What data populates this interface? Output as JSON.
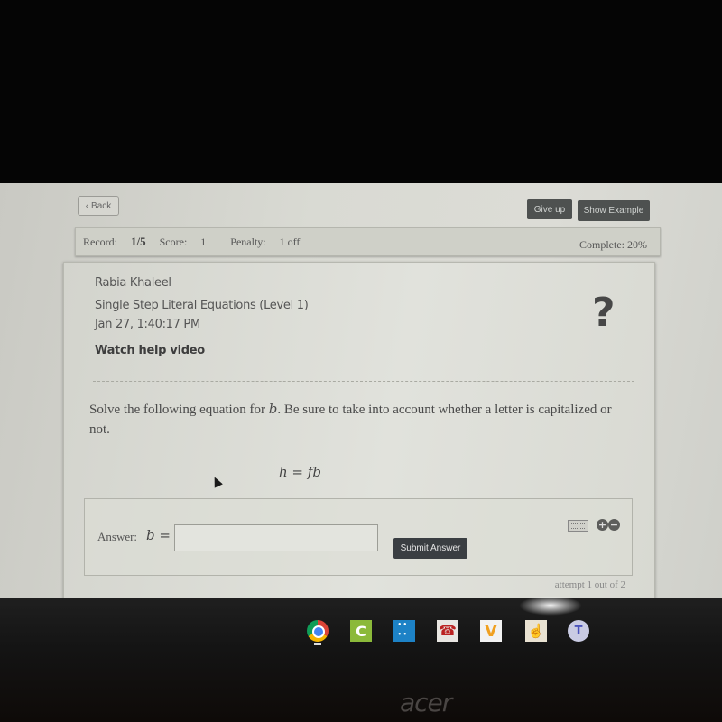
{
  "nav": {
    "back_label": "Back",
    "back_icon": "chevron-left-icon",
    "give_up_label": "Give up",
    "show_example_label": "Show Example"
  },
  "status": {
    "record_label": "Record:",
    "record_value": "1/5",
    "score_label": "Score:",
    "score_value": "1",
    "penalty_label": "Penalty:",
    "penalty_value": "1 off",
    "complete_label": "Complete:",
    "complete_value": "20%"
  },
  "header": {
    "student_name": "Rabia Khaleel",
    "skill_title": "Single Step Literal Equations (Level 1)",
    "timestamp": "Jan 27, 1:40:17 PM",
    "help_link": "Watch help video",
    "help_icon": "question-mark-icon"
  },
  "problem": {
    "prompt_before": "Solve the following equation for ",
    "variable": "b",
    "prompt_after": ". Be sure to take into account whether a letter is capitalized or not.",
    "equation": "h = fb"
  },
  "answer": {
    "label": "Answer:",
    "lhs": "b =",
    "value": "",
    "placeholder": "",
    "submit_label": "Submit Answer",
    "keyboard_icon": "keyboard-icon",
    "plus_label": "+",
    "minus_label": "−",
    "attempt_text": "attempt 1 out of 2"
  },
  "taskbar": {
    "apps": [
      "Chrome",
      "Classroom",
      "Dots app",
      "Phone app",
      "V app",
      "Hand app",
      "Teams"
    ],
    "classroom_letter": "C",
    "v_letter": "V",
    "teams_letter": "T"
  },
  "device": {
    "brand": "acer"
  }
}
